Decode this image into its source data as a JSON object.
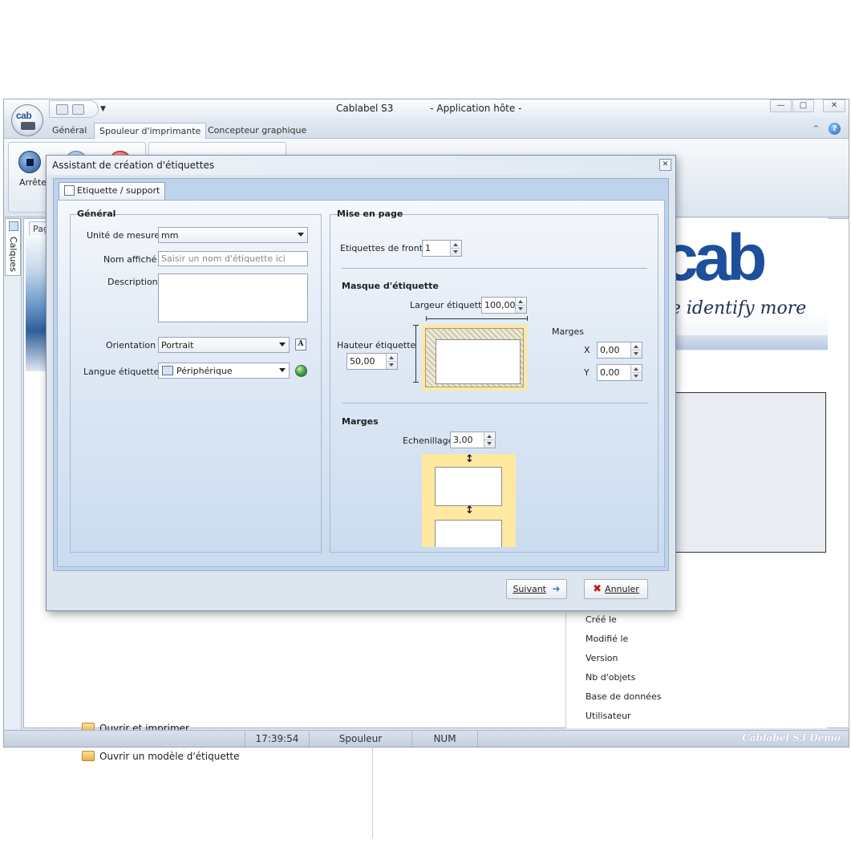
{
  "window": {
    "title": "Cablabel S3",
    "subtitle": "- Application hôte -",
    "logo": "cab",
    "controls": [
      "minimize-icon",
      "maximize-icon",
      "close-icon"
    ]
  },
  "ribbon": {
    "tabs": [
      {
        "label": "Général",
        "active": false
      },
      {
        "label": "Spouleur d'imprimante",
        "active": true
      },
      {
        "label": "Concepteur graphique",
        "active": false
      }
    ],
    "stop_label": "Arrêter",
    "side_tab": "Calques",
    "doc_tab": "Page"
  },
  "banner": {
    "logo": "cab",
    "tagline": "we identify more"
  },
  "main": {
    "open_links": [
      "Ouvrir et imprimer",
      "Ouvrir un modèle d'étiquette"
    ],
    "properties": [
      "Créé le",
      "Modifié le",
      "Version",
      "Nb d'objets",
      "Base de données",
      "Utilisateur"
    ]
  },
  "statusbar": {
    "time": "17:39:54",
    "mode": "Spouleur",
    "num": "NUM",
    "edition": "Cablabel S3 Demo"
  },
  "dialog": {
    "title": "Assistant de création d'étiquettes",
    "tab": "Etiquette / support",
    "general": {
      "title": "Général",
      "unit_label": "Unité de mesure",
      "unit_value": "mm",
      "display_name_label": "Nom affiché",
      "display_name_placeholder": "Saisir un nom d'étiquette ici",
      "description_label": "Description",
      "orientation_label": "Orientation",
      "orientation_value": "Portrait",
      "language_label": "Langue étiquette",
      "language_value": "Périphérique"
    },
    "layout": {
      "title": "Mise en page",
      "labels_front_label": "Etiquettes de front",
      "labels_front_value": "1",
      "mask_title": "Masque d'étiquette",
      "width_label": "Largeur étiquette",
      "width_value": "100,00",
      "height_label": "Hauteur étiquette",
      "height_value": "50,00",
      "margins_label": "Marges",
      "x_label": "X",
      "x_value": "0,00",
      "y_label": "Y",
      "y_value": "0,00",
      "margins_title": "Marges",
      "gap_label": "Echenillage",
      "gap_value": "3,00"
    },
    "buttons": {
      "next": "Suivant",
      "cancel": "Annuler"
    },
    "colors": {
      "label_frame": "#ffe9a0",
      "tab_page": "#c9dbf0"
    }
  }
}
